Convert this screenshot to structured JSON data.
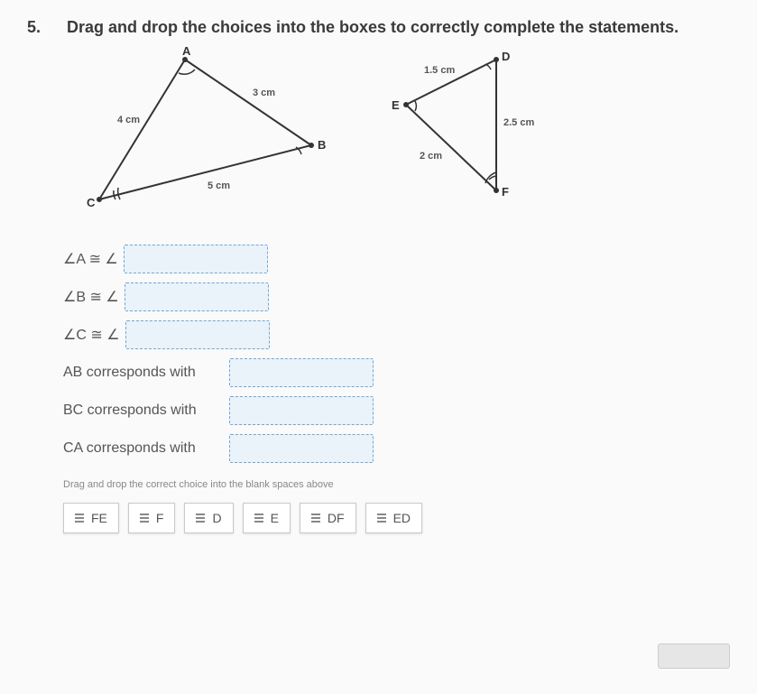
{
  "problem": {
    "number": "5.",
    "instruction": "Drag and drop the choices into the boxes to correctly complete the statements."
  },
  "triangle1": {
    "vertices": {
      "A": "A",
      "B": "B",
      "C": "C"
    },
    "sides": {
      "AC": "4 cm",
      "AB": "3 cm",
      "CB": "5 cm"
    }
  },
  "triangle2": {
    "vertices": {
      "D": "D",
      "E": "E",
      "F": "F"
    },
    "sides": {
      "ED": "1.5 cm",
      "EF": "2 cm",
      "DF": "2.5 cm"
    }
  },
  "statements": {
    "s1": "∠A ≅ ∠",
    "s2": "∠B ≅ ∠",
    "s3": "∠C ≅ ∠",
    "s4": "AB corresponds with",
    "s5": "BC corresponds with",
    "s6": "CA corresponds with"
  },
  "hint": "Drag and drop the correct choice into the blank spaces above",
  "choices": {
    "c1": "FE",
    "c2": "F",
    "c3": "D",
    "c4": "E",
    "c5": "DF",
    "c6": "ED"
  }
}
